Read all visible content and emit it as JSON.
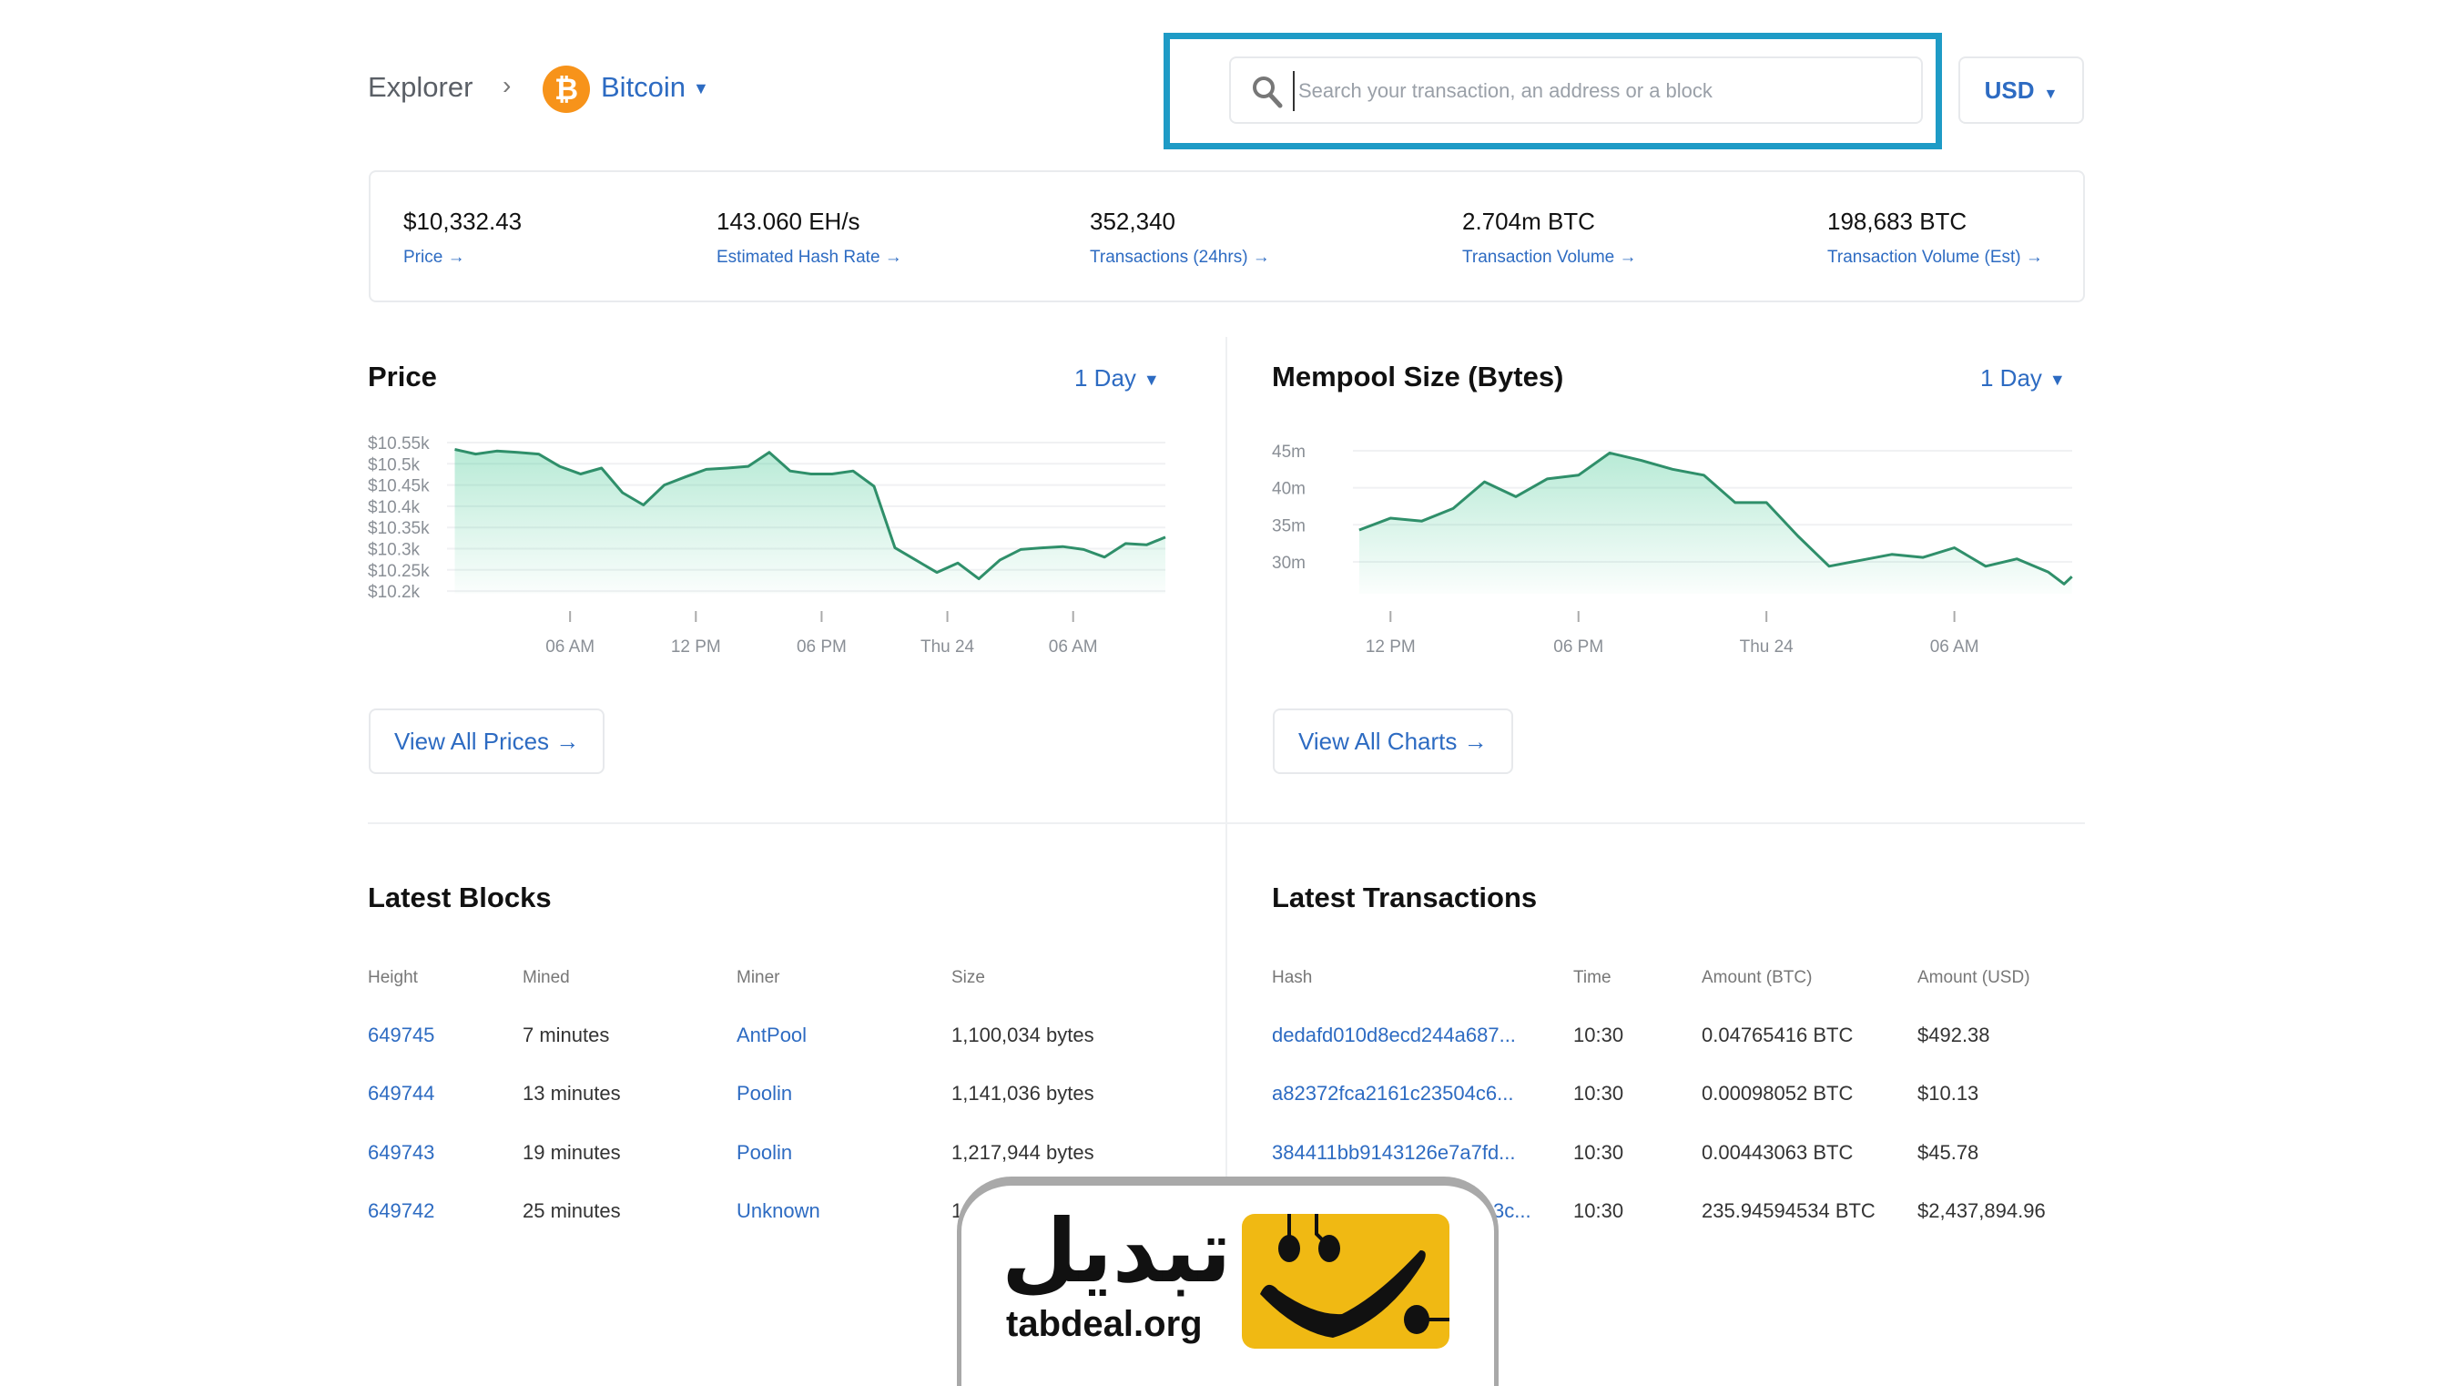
{
  "breadcrumb": {
    "root": "Explorer",
    "separator": "›",
    "coin": "Bitcoin",
    "coin_icon": "bitcoin-icon",
    "coin_color": "#f7931a"
  },
  "search": {
    "placeholder": "Search your transaction, an address or a block",
    "value": "",
    "highlight_color": "#1e9bc6"
  },
  "currency": {
    "selected": "USD"
  },
  "stats": [
    {
      "value": "$10,332.43",
      "label": "Price →"
    },
    {
      "value": "143.060 EH/s",
      "label": "Estimated Hash Rate →"
    },
    {
      "value": "352,340",
      "label": "Transactions (24hrs) →"
    },
    {
      "value": "2.704m BTC",
      "label": "Transaction Volume →"
    },
    {
      "value": "198,683 BTC",
      "label": "Transaction Volume (Est) →"
    }
  ],
  "price_panel": {
    "title": "Price",
    "range": "1 Day",
    "button": "View All Prices →"
  },
  "mempool_panel": {
    "title": "Mempool Size (Bytes)",
    "range": "1 Day",
    "button": "View All Charts →"
  },
  "chart_data": [
    {
      "type": "area",
      "title": "Price",
      "yticks": [
        "$10.55k",
        "$10.5k",
        "$10.45k",
        "$10.4k",
        "$10.35k",
        "$10.3k",
        "$10.25k",
        "$10.2k"
      ],
      "ytick_values": [
        10.55,
        10.5,
        10.45,
        10.4,
        10.35,
        10.3,
        10.25,
        10.2
      ],
      "xticks": [
        "06 AM",
        "12 PM",
        "06 PM",
        "Thu 24",
        "06 AM"
      ],
      "xtick_times": [
        "Wed 06:00",
        "Wed 12:00",
        "Wed 18:00",
        "Thu 00:00",
        "Thu 06:00"
      ],
      "ylim": [
        10.2,
        10.55
      ],
      "unit": "$k",
      "grid": true,
      "line_color": "#2f8f6a",
      "points": [
        [
          "Wed 00:30",
          10.534
        ],
        [
          "Wed 01:30",
          10.523
        ],
        [
          "Wed 02:30",
          10.53
        ],
        [
          "Wed 03:30",
          10.527
        ],
        [
          "Wed 04:30",
          10.523
        ],
        [
          "Wed 05:30",
          10.494
        ],
        [
          "Wed 06:30",
          10.476
        ],
        [
          "Wed 07:30",
          10.49
        ],
        [
          "Wed 08:30",
          10.432
        ],
        [
          "Wed 09:30",
          10.403
        ],
        [
          "Wed 10:30",
          10.45
        ],
        [
          "Wed 11:30",
          10.469
        ],
        [
          "Wed 12:30",
          10.487
        ],
        [
          "Wed 13:30",
          10.49
        ],
        [
          "Wed 14:30",
          10.494
        ],
        [
          "Wed 15:30",
          10.527
        ],
        [
          "Wed 16:30",
          10.483
        ],
        [
          "Wed 17:30",
          10.476
        ],
        [
          "Wed 18:30",
          10.476
        ],
        [
          "Wed 19:30",
          10.483
        ],
        [
          "Wed 20:30",
          10.447
        ],
        [
          "Wed 21:30",
          10.302
        ],
        [
          "Wed 22:30",
          10.273
        ],
        [
          "Wed 23:30",
          10.244
        ],
        [
          "Thu 00:30",
          10.266
        ],
        [
          "Thu 01:30",
          10.229
        ],
        [
          "Thu 02:30",
          10.273
        ],
        [
          "Thu 03:30",
          10.298
        ],
        [
          "Thu 04:30",
          10.302
        ],
        [
          "Thu 05:30",
          10.305
        ],
        [
          "Thu 06:30",
          10.298
        ],
        [
          "Thu 07:30",
          10.28
        ],
        [
          "Thu 08:30",
          10.312
        ],
        [
          "Thu 09:30",
          10.309
        ],
        [
          "Thu 10:24",
          10.327
        ]
      ]
    },
    {
      "type": "area",
      "title": "Mempool Size (Bytes)",
      "yticks": [
        "45m",
        "40m",
        "35m",
        "30m"
      ],
      "ytick_values": [
        45,
        40,
        35,
        30
      ],
      "xticks": [
        "12 PM",
        "06 PM",
        "Thu 24",
        "06 AM"
      ],
      "xtick_times": [
        "Wed 12:00",
        "Wed 18:00",
        "Thu 00:00",
        "Thu 06:00"
      ],
      "unit": "m bytes",
      "grid": true,
      "line_color": "#2f8f6a",
      "points": [
        [
          "Wed 11:00",
          34.3
        ],
        [
          "Wed 12:00",
          35.9
        ],
        [
          "Wed 13:00",
          35.5
        ],
        [
          "Wed 14:00",
          37.2
        ],
        [
          "Wed 15:00",
          40.8
        ],
        [
          "Wed 16:00",
          38.8
        ],
        [
          "Wed 17:00",
          41.2
        ],
        [
          "Wed 18:00",
          41.7
        ],
        [
          "Wed 19:00",
          44.7
        ],
        [
          "Wed 20:00",
          43.7
        ],
        [
          "Wed 21:00",
          42.5
        ],
        [
          "Wed 22:00",
          41.7
        ],
        [
          "Wed 23:00",
          38.0
        ],
        [
          "Thu 00:00",
          38.0
        ],
        [
          "Thu 01:00",
          33.5
        ],
        [
          "Thu 02:00",
          29.4
        ],
        [
          "Thu 03:00",
          30.2
        ],
        [
          "Thu 04:00",
          31.0
        ],
        [
          "Thu 05:00",
          30.6
        ],
        [
          "Thu 06:00",
          31.9
        ],
        [
          "Thu 07:00",
          29.4
        ],
        [
          "Thu 08:00",
          30.4
        ],
        [
          "Thu 09:00",
          28.6
        ],
        [
          "Thu 09:30",
          27.0
        ],
        [
          "Thu 09:45",
          28.0
        ]
      ]
    }
  ],
  "latest_blocks": {
    "title": "Latest Blocks",
    "columns": [
      "Height",
      "Mined",
      "Miner",
      "Size"
    ],
    "rows": [
      [
        "649745",
        "7 minutes",
        "AntPool",
        "1,100,034 bytes"
      ],
      [
        "649744",
        "13 minutes",
        "Poolin",
        "1,141,036 bytes"
      ],
      [
        "649743",
        "19 minutes",
        "Poolin",
        "1,217,944 bytes"
      ],
      [
        "649742",
        "25 minutes",
        "Unknown",
        "1"
      ]
    ]
  },
  "latest_transactions": {
    "title": "Latest Transactions",
    "columns": [
      "Hash",
      "Time",
      "Amount (BTC)",
      "Amount (USD)"
    ],
    "rows": [
      [
        "dedafd010d8ecd244a687...",
        "10:30",
        "0.04765416 BTC",
        "$492.38"
      ],
      [
        "a82372fca2161c23504c6...",
        "10:30",
        "0.00098052 BTC",
        "$10.13"
      ],
      [
        "384411bb9143126e7a7fd...",
        "10:30",
        "0.00443063 BTC",
        "$45.78"
      ],
      [
        "3c...",
        "10:30",
        "235.94594534 BTC",
        "$2,437,894.96"
      ]
    ]
  },
  "watermark": {
    "arabic": "تبدیل",
    "latin": "tabdeal.org",
    "brand_color": "#f0b913"
  }
}
